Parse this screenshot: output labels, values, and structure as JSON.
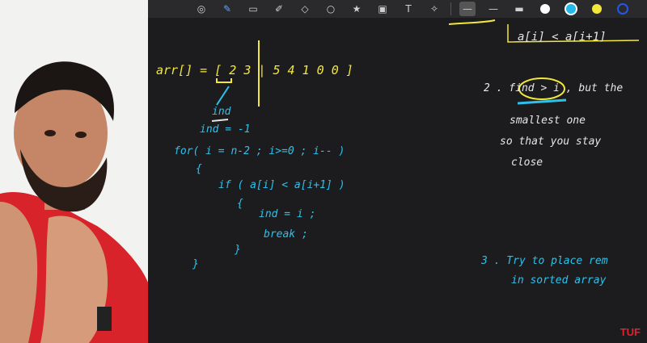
{
  "toolbar": {
    "tools": [
      "lasso-icon",
      "pen-icon",
      "eraser-icon",
      "highlighter-icon",
      "shapes-icon",
      "lasso-select-icon",
      "sticker-icon",
      "image-icon",
      "text-icon",
      "laser-icon"
    ],
    "colors": [
      "#ffffff",
      "#24b9e8",
      "#f3e83a",
      "#2457e8"
    ]
  },
  "board": {
    "arr_line": "arr[] = [ 2  3 |  5   4   1   0   0 ]",
    "ind_label": "ind",
    "ind_init": "ind = -1",
    "for_line": "for( i = n-2 ; i>=0 ; i-- )",
    "brace_open": "{",
    "if_line": "if ( a[i] < a[i+1] )",
    "inner_brace_open": "{",
    "assign_line": "ind = i ;",
    "break_line": "break ;",
    "inner_brace_close": "}",
    "brace_close": "}",
    "top_note": "a[i] < a[i+1]",
    "step2_line1": "2 . find > i , but the",
    "step2_line2": "smallest one",
    "step2_line3": "so that you stay",
    "step2_line4": "close",
    "step3_line1": "3 . Try to place rem",
    "step3_line2": "in sorted array"
  },
  "brand": {
    "logo": "TUF"
  }
}
